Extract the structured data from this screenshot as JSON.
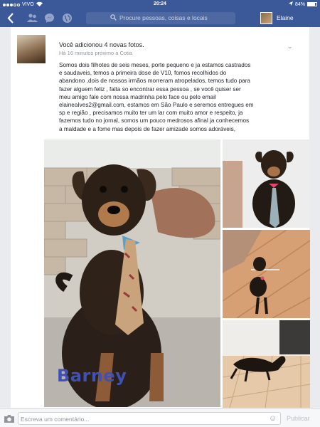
{
  "status_bar": {
    "carrier": "VIVO",
    "time": "20:24",
    "battery_text": "84%",
    "battery_level": 0.84
  },
  "nav": {
    "search_placeholder": "Procure pessoas, coisas e locais",
    "user_name": "Elaine",
    "back_icon": "chevron-left-icon",
    "icons": [
      "friend-requests-icon",
      "messages-icon",
      "notifications-globe-icon",
      "search-icon"
    ]
  },
  "post": {
    "title": "Você adicionou 4 novas fotos.",
    "meta": "Há 16 minutos próximo a Cotia",
    "text_lines": [
      "Somos dois filhotes de seis meses, porte pequeno e ja estamos castrados",
      "e saudaveis, temos a primeira dose de V10, fomos recolhidos do",
      "abandono ,dois de nossos irmãos morreram atropelados, temos tudo para",
      "fazer alguem feliz , falta so encontrar essa pessoa , se você quiser ser",
      "meu amigo fale com nossa madrinha pelo face ou pelo email",
      "elaineaIves2@gmail.com, estamos em São Paulo e seremos entregues em",
      "sp e região , precisamos muito ter um lar com muito amor e respeito, ja",
      "fazemos tudo no jornal, somos um pouco medrosos afinal ja conhecemos",
      "a maldade e a fome mas depois de fazer amizade somos adoráveis,"
    ],
    "photo_caption": "Barney",
    "caret_icon": "chevron-down-icon"
  },
  "comment_bar": {
    "placeholder": "Escreva um comentário...",
    "publish_label": "Publicar",
    "camera_icon": "camera-icon",
    "emoji_icon": "emoji-icon"
  },
  "colors": {
    "brand": "#3b5998",
    "caption": "#3f51b5"
  }
}
